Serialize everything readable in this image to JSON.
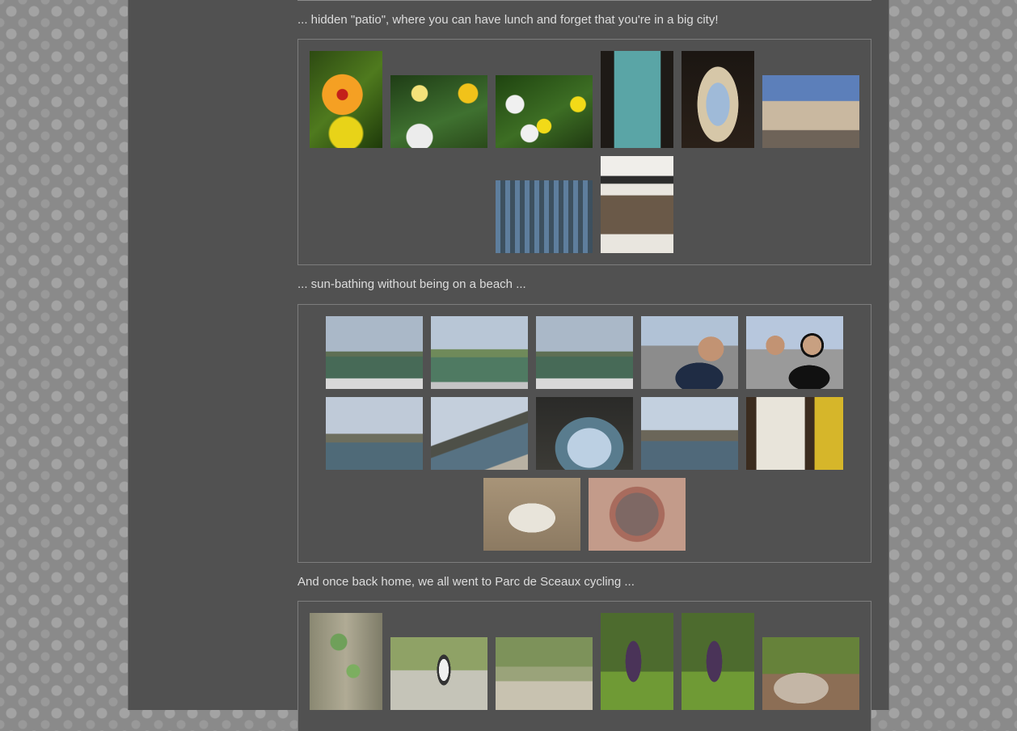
{
  "captions": {
    "patio": "... hidden \"patio\", where you can have lunch and forget that you're in a big city!",
    "sunbathing": "... sun-bathing without being on a beach ...",
    "cycling": "And once back home, we all went to Parc de Sceaux cycling ..."
  },
  "galleries": {
    "patio": [
      "hibiscus flower",
      "calla lilies",
      "sunflowers",
      "teal plaque",
      "archway",
      "shopping street",
      "la madeleine",
      "anne fontaine shop"
    ],
    "sunbathing": [
      "pond view 1",
      "pond view 2",
      "pond view 3",
      "man on chair",
      "couple selfie",
      "seine riverbank",
      "seine quay",
      "under bridge",
      "musee d'orsay",
      "wall poster",
      "oscar wilde plaque",
      "manhole cover"
    ],
    "cycling": [
      "ivy on tree",
      "girl on bicycle",
      "kids cycling",
      "girls 1",
      "girls 2",
      "tree climbing"
    ]
  }
}
